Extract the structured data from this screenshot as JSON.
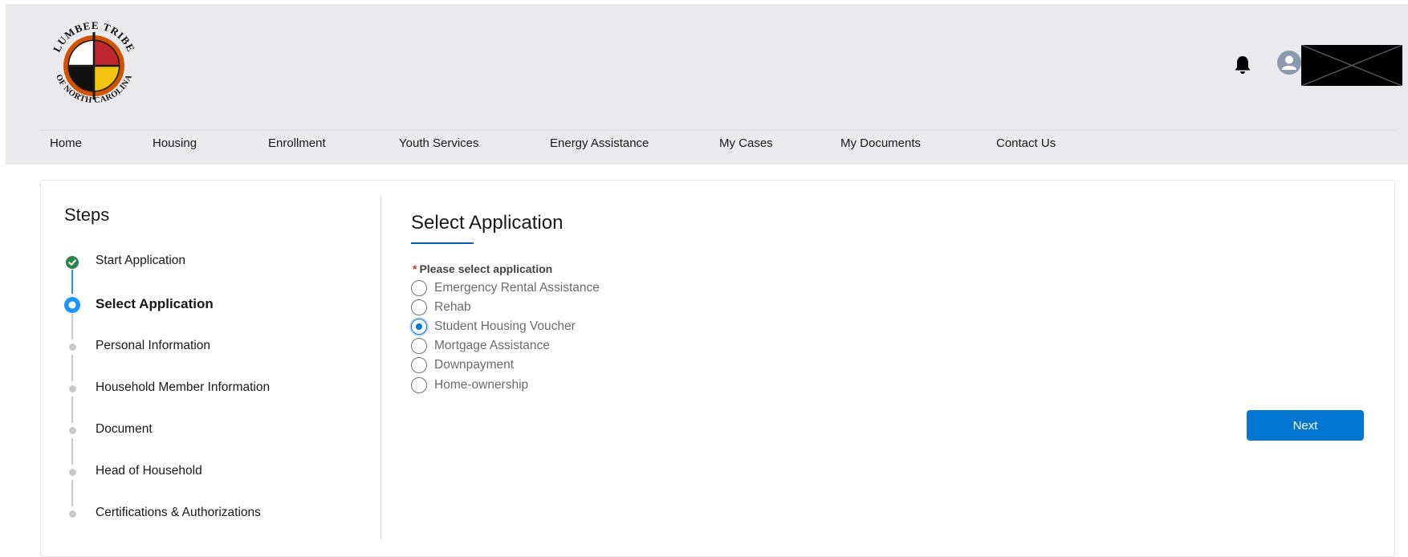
{
  "header": {
    "logo_text_top": "LUMBEE TRIBE",
    "logo_text_bottom": "OF NORTH CAROLINA",
    "bell_icon": "bell-icon",
    "avatar_icon": "user-avatar-icon"
  },
  "nav": {
    "items": [
      {
        "label": "Home"
      },
      {
        "label": "Housing"
      },
      {
        "label": "Enrollment"
      },
      {
        "label": "Youth Services"
      },
      {
        "label": "Energy Assistance"
      },
      {
        "label": "My Cases"
      },
      {
        "label": "My Documents"
      },
      {
        "label": "Contact Us"
      }
    ]
  },
  "steps": {
    "title": "Steps",
    "items": [
      {
        "label": "Start Application",
        "status": "complete"
      },
      {
        "label": "Select Application",
        "status": "current"
      },
      {
        "label": "Personal Information",
        "status": "pending"
      },
      {
        "label": "Household Member Information",
        "status": "pending"
      },
      {
        "label": "Document",
        "status": "pending"
      },
      {
        "label": "Head of Household",
        "status": "pending"
      },
      {
        "label": "Certifications & Authorizations",
        "status": "pending"
      }
    ]
  },
  "form": {
    "title": "Select Application",
    "required_marker": "*",
    "field_label": "Please select application",
    "options": [
      {
        "label": "Emergency Rental Assistance",
        "checked": false
      },
      {
        "label": "Rehab",
        "checked": false
      },
      {
        "label": "Student Housing Voucher",
        "checked": true
      },
      {
        "label": "Mortgage Assistance",
        "checked": false
      },
      {
        "label": "Downpayment",
        "checked": false
      },
      {
        "label": "Home-ownership",
        "checked": false
      }
    ],
    "next_label": "Next"
  },
  "colors": {
    "brand_blue": "#0176d3",
    "complete_green": "#2e844a",
    "header_bg": "#ebebed"
  }
}
